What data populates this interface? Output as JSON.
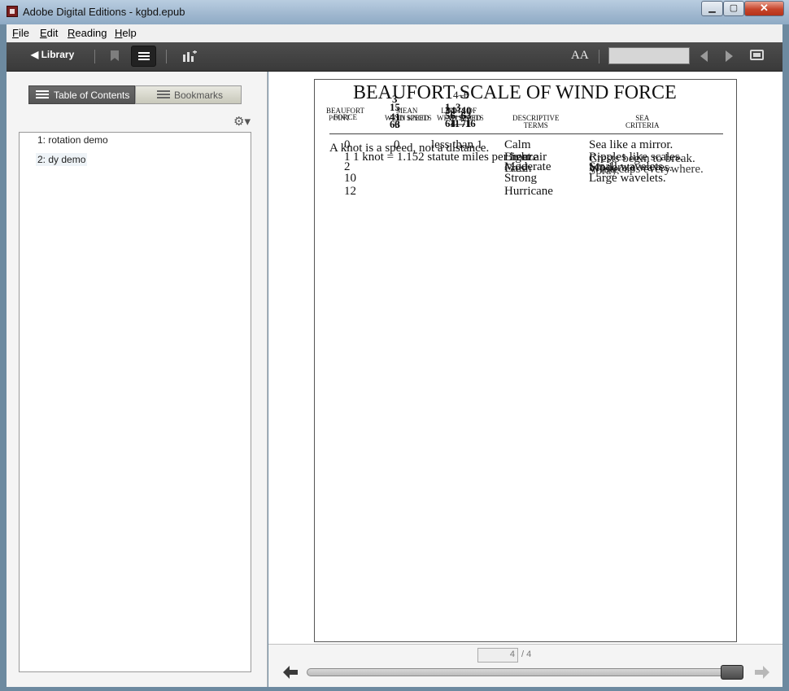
{
  "window": {
    "title": "Adobe Digital Editions - kgbd.epub",
    "minimize": "▁",
    "maximize": "▢",
    "close": "✕"
  },
  "menu": [
    "File",
    "Edit",
    "Reading",
    "Help"
  ],
  "toolbar": {
    "library_label": "◀ Library",
    "font_glyph": "AA"
  },
  "sidebar": {
    "tabs": [
      "Table of Contents",
      "Bookmarks"
    ],
    "toc": [
      "1: rotation demo",
      "2: dy demo"
    ]
  },
  "page": {
    "title": "BEAUFORT SCALE OF WIND FORCE",
    "overlay_title": "4–6",
    "headers": {
      "force": [
        "BEAUFORT",
        "FORCE",
        "POINT"
      ],
      "mean": [
        "MEAN",
        "WIND SPEED",
        "IN KNOTS"
      ],
      "limits": [
        "LIMITS OF",
        "WIND SPEED",
        "IN KNOTS"
      ],
      "desc": [
        "DESCRIPTIVE",
        "TERMS"
      ],
      "sea": [
        "SEA",
        "CRITERIA"
      ]
    },
    "stacked_numbers": {
      "force": [
        "0",
        "1",
        "2",
        "10",
        "12"
      ],
      "mean": [
        "3",
        "15",
        "41",
        "63",
        "6"
      ],
      "limits": [
        "1–3",
        "34–40",
        "56–63",
        "64–71",
        "11–16"
      ]
    },
    "rows": [
      {
        "force": "0",
        "mean": "0",
        "limits": "less than 1",
        "desc": "Calm",
        "sea": "Sea like a mirror."
      },
      {
        "force": "1",
        "mean": "",
        "limits": "",
        "desc": "Light air",
        "sea": "Ripples like scales."
      },
      {
        "force": "2",
        "mean": "",
        "limits": "",
        "desc": "Breeze",
        "sea": "Small wavelets."
      },
      {
        "force": "10",
        "mean": "",
        "limits": "",
        "desc": "Strong",
        "sea": "Large wavelets."
      },
      {
        "force": "12",
        "mean": "",
        "limits": "",
        "desc": "Hurricane",
        "sea": ""
      }
    ],
    "note_line1": "A knot is a speed, not a distance.",
    "note_line2": "1 knot = 1.152 statute miles per hour.",
    "sea_overlays": [
      "Crests begin to break.",
      "Moderate waves.",
      "Whitecaps everywhere.",
      "Spray."
    ],
    "desc_overlays": [
      "Moderate",
      "Fresh",
      "Gale"
    ]
  },
  "footer": {
    "current_page": "4",
    "total_label": "/ 4"
  }
}
